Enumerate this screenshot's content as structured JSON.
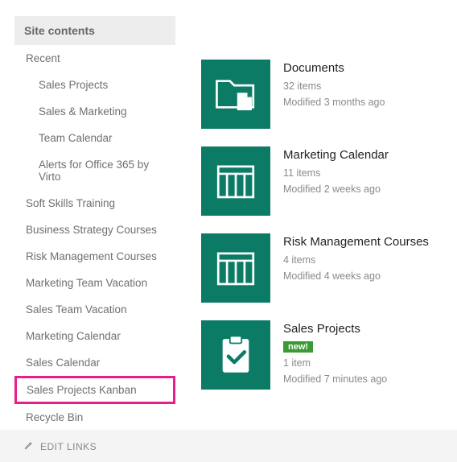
{
  "sidebar": {
    "header": "Site contents",
    "recent_label": "Recent",
    "recent_items": [
      "Sales Projects",
      "Sales & Marketing",
      "Team Calendar",
      "Alerts for Office 365 by Virto"
    ],
    "items": [
      "Soft Skills Training",
      "Business Strategy Courses",
      "Risk Management Courses",
      "Marketing Team Vacation",
      "Sales Team Vacation",
      "Marketing Calendar",
      "Sales Calendar",
      "Sales Projects Kanban",
      "Recycle Bin"
    ],
    "highlight_index": 7,
    "edit_links": "EDIT LINKS"
  },
  "tiles": [
    {
      "icon": "folder-file",
      "title": "Documents",
      "count": "32 items",
      "modified": "Modified 3 months ago"
    },
    {
      "icon": "calendar",
      "title": "Marketing Calendar",
      "count": "11 items",
      "modified": "Modified 2 weeks ago"
    },
    {
      "icon": "calendar",
      "title": "Risk Management Courses",
      "count": "4 items",
      "modified": "Modified 4 weeks ago"
    },
    {
      "icon": "clipboard-check",
      "title": "Sales Projects",
      "badge": "new!",
      "count": "1 item",
      "modified": "Modified 7 minutes ago"
    }
  ],
  "colors": {
    "tile": "#0b7b65",
    "highlight": "#e91e8c",
    "badge": "#3a9b35"
  }
}
